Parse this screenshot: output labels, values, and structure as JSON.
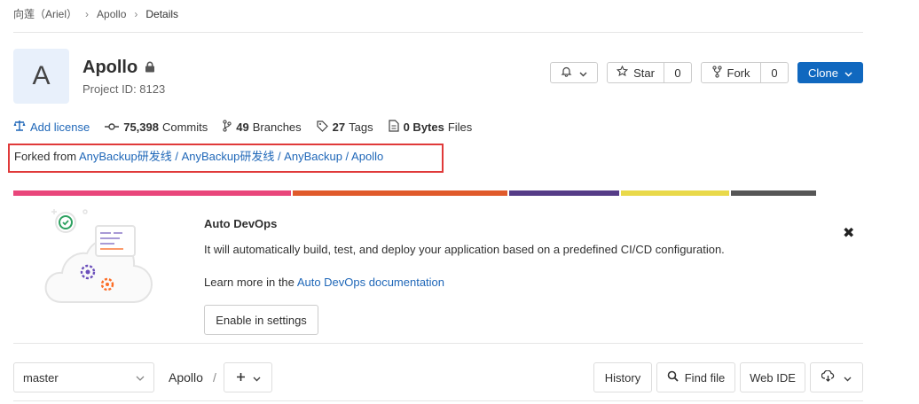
{
  "breadcrumb": {
    "items": [
      "向莲（Ariel）",
      "Apollo",
      "Details"
    ]
  },
  "project": {
    "avatar_letter": "A",
    "name": "Apollo",
    "id_text": "Project ID: 8123"
  },
  "actions": {
    "star_label": "Star",
    "star_count": "0",
    "fork_label": "Fork",
    "fork_count": "0",
    "clone_label": "Clone"
  },
  "stats": {
    "add_license": "Add license",
    "commits_count": "75,398",
    "commits_label": "Commits",
    "branches_count": "49",
    "branches_label": "Branches",
    "tags_count": "27",
    "tags_label": "Tags",
    "files_size": "0 Bytes",
    "files_label": "Files"
  },
  "forked": {
    "prefix": "Forked from",
    "link": "AnyBackup研发线 / AnyBackup研发线 / AnyBackup / Apollo"
  },
  "color_bar": [
    "#e9467b",
    "#e05a2b",
    "#553c87",
    "#e9d94a",
    "#565656"
  ],
  "devops": {
    "title": "Auto DevOps",
    "description": "It will automatically build, test, and deploy your application based on a predefined CI/CD configuration.",
    "learn_prefix": "Learn more in the",
    "learn_link": "Auto DevOps documentation",
    "enable_button": "Enable in settings"
  },
  "repo_bar": {
    "branch": "master",
    "path_root": "Apollo",
    "path_sep": "/",
    "history": "History",
    "find_file": "Find file",
    "web_ide": "Web IDE"
  }
}
